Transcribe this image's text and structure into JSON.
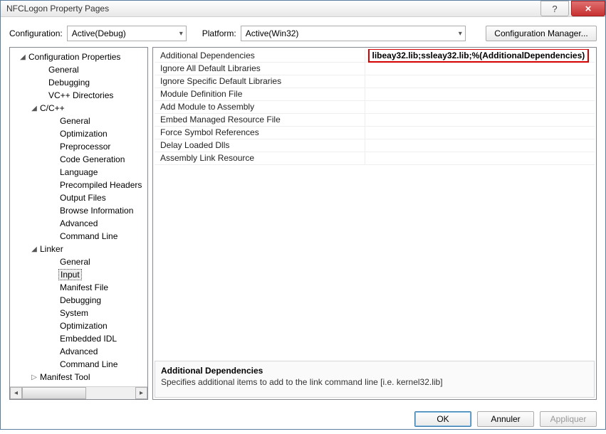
{
  "window": {
    "title": "NFCLogon Property Pages"
  },
  "titlebar": {
    "help_glyph": "?",
    "close_glyph": "×"
  },
  "top": {
    "config_label": "Configuration:",
    "config_value": "Active(Debug)",
    "platform_label": "Platform:",
    "platform_value": "Active(Win32)",
    "manager_btn": "Configuration Manager..."
  },
  "tree": {
    "items": [
      {
        "pad": 12,
        "exp": "▢",
        "label": "Configuration Properties"
      },
      {
        "pad": 40,
        "exp": "",
        "label": "General"
      },
      {
        "pad": 40,
        "exp": "",
        "label": "Debugging"
      },
      {
        "pad": 40,
        "exp": "",
        "label": "VC++ Directories"
      },
      {
        "pad": 28,
        "exp": "▢",
        "label": "C/C++"
      },
      {
        "pad": 56,
        "exp": "",
        "label": "General"
      },
      {
        "pad": 56,
        "exp": "",
        "label": "Optimization"
      },
      {
        "pad": 56,
        "exp": "",
        "label": "Preprocessor"
      },
      {
        "pad": 56,
        "exp": "",
        "label": "Code Generation"
      },
      {
        "pad": 56,
        "exp": "",
        "label": "Language"
      },
      {
        "pad": 56,
        "exp": "",
        "label": "Precompiled Headers"
      },
      {
        "pad": 56,
        "exp": "",
        "label": "Output Files"
      },
      {
        "pad": 56,
        "exp": "",
        "label": "Browse Information"
      },
      {
        "pad": 56,
        "exp": "",
        "label": "Advanced"
      },
      {
        "pad": 56,
        "exp": "",
        "label": "Command Line"
      },
      {
        "pad": 28,
        "exp": "▢",
        "label": "Linker"
      },
      {
        "pad": 56,
        "exp": "",
        "label": "General"
      },
      {
        "pad": 56,
        "exp": "",
        "label": "Input",
        "selected": true
      },
      {
        "pad": 56,
        "exp": "",
        "label": "Manifest File"
      },
      {
        "pad": 56,
        "exp": "",
        "label": "Debugging"
      },
      {
        "pad": 56,
        "exp": "",
        "label": "System"
      },
      {
        "pad": 56,
        "exp": "",
        "label": "Optimization"
      },
      {
        "pad": 56,
        "exp": "",
        "label": "Embedded IDL"
      },
      {
        "pad": 56,
        "exp": "",
        "label": "Advanced"
      },
      {
        "pad": 56,
        "exp": "",
        "label": "Command Line"
      },
      {
        "pad": 28,
        "exp": "▷",
        "label": "Manifest Tool"
      }
    ]
  },
  "props": {
    "rows": [
      {
        "key": "Additional Dependencies",
        "val": "libeay32.lib;ssleay32.lib;%(AdditionalDependencies)",
        "highlight": true
      },
      {
        "key": "Ignore All Default Libraries",
        "val": ""
      },
      {
        "key": "Ignore Specific Default Libraries",
        "val": ""
      },
      {
        "key": "Module Definition File",
        "val": ""
      },
      {
        "key": "Add Module to Assembly",
        "val": ""
      },
      {
        "key": "Embed Managed Resource File",
        "val": ""
      },
      {
        "key": "Force Symbol References",
        "val": ""
      },
      {
        "key": "Delay Loaded Dlls",
        "val": ""
      },
      {
        "key": "Assembly Link Resource",
        "val": ""
      }
    ]
  },
  "desc": {
    "title": "Additional Dependencies",
    "text": "Specifies additional items to add to the link command line [i.e. kernel32.lib]"
  },
  "buttons": {
    "ok": "OK",
    "cancel": "Annuler",
    "apply": "Appliquer"
  }
}
